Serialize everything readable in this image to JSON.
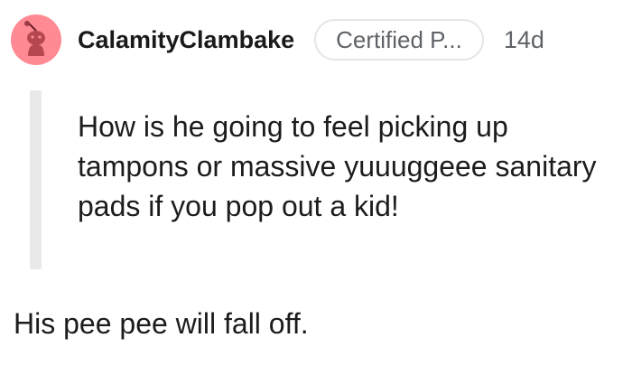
{
  "comment": {
    "username": "CalamityClambake",
    "flair": "Certified P...",
    "timestamp": "14d",
    "avatar_icon": "reddit-snoo-icon",
    "avatar_color": "#ff8a93",
    "quote_text": "How is he going to feel picking up tampons or massive yuuuggeee sanitary pads if you pop out a kid!",
    "body_text": "His pee pee will fall off."
  }
}
